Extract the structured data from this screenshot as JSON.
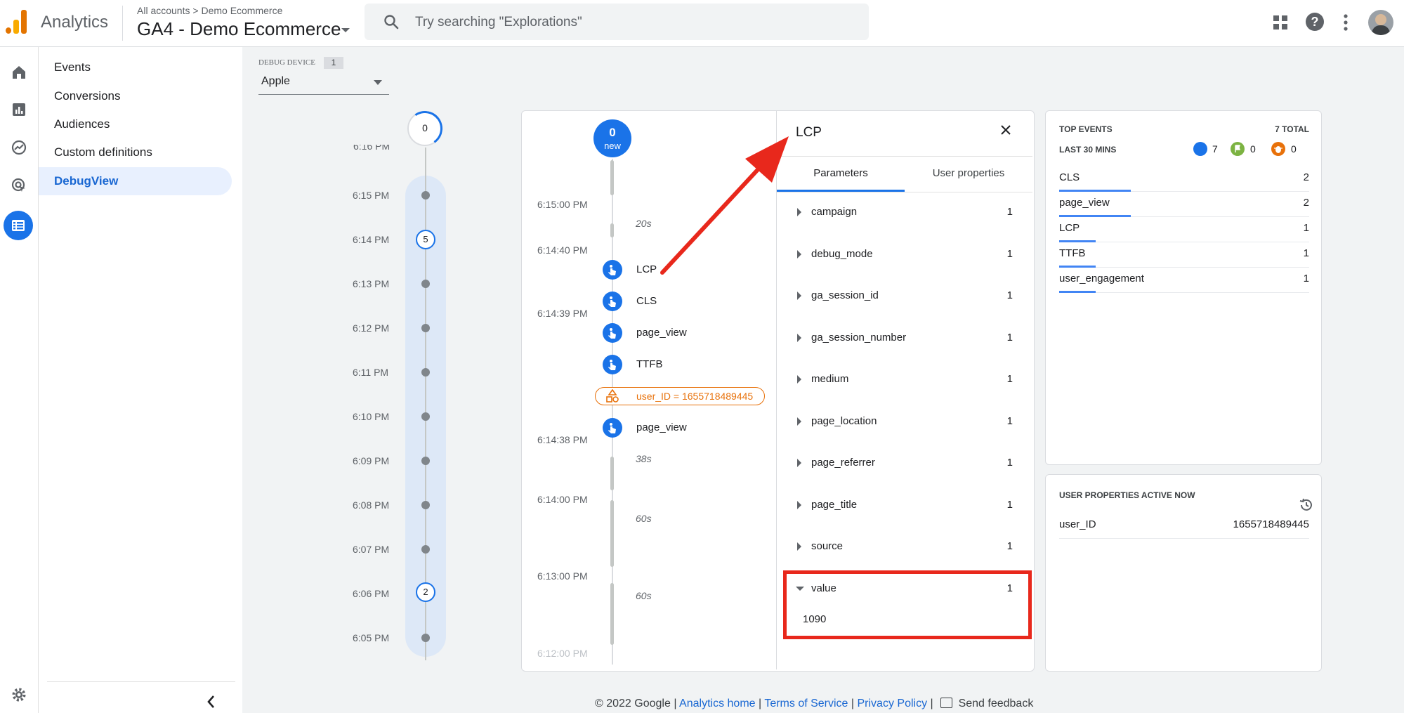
{
  "header": {
    "app_name": "Analytics",
    "breadcrumb_root": "All accounts",
    "breadcrumb_sep": ">",
    "breadcrumb_account": "Demo Ecommerce",
    "property_name": "GA4 - Demo Ecommerce",
    "search_placeholder": "Try searching \"Explorations\""
  },
  "nav": {
    "items": [
      {
        "label": "Events"
      },
      {
        "label": "Conversions"
      },
      {
        "label": "Audiences"
      },
      {
        "label": "Custom definitions"
      },
      {
        "label": "DebugView"
      }
    ]
  },
  "debug_device": {
    "label": "DEBUG DEVICE",
    "count": "1",
    "selected": "Apple"
  },
  "minutes_timeline": {
    "top_count": "0",
    "partial_label": "6:16 PM",
    "labels": [
      "6:15 PM",
      "6:14 PM",
      "6:13 PM",
      "6:12 PM",
      "6:11 PM",
      "6:10 PM",
      "6:09 PM",
      "6:08 PM",
      "6:07 PM",
      "6:06 PM",
      "6:05 PM"
    ],
    "badge_614": "5",
    "badge_606": "2"
  },
  "seconds_stream": {
    "new_count": "0",
    "new_label": "new",
    "times": [
      "6:15:00 PM",
      "6:14:40 PM",
      "6:14:39 PM",
      "6:14:38 PM",
      "6:14:00 PM",
      "6:13:00 PM",
      "6:12:00 PM"
    ],
    "gaps": [
      "20s",
      "38s",
      "60s",
      "60s"
    ],
    "events": [
      "LCP",
      "CLS",
      "page_view",
      "TTFB",
      "page_view"
    ],
    "user_property": "user_ID = 1655718489445"
  },
  "event_detail": {
    "title": "LCP",
    "tabs": [
      "Parameters",
      "User properties"
    ],
    "params": [
      {
        "name": "campaign",
        "count": "1"
      },
      {
        "name": "debug_mode",
        "count": "1"
      },
      {
        "name": "ga_session_id",
        "count": "1"
      },
      {
        "name": "ga_session_number",
        "count": "1"
      },
      {
        "name": "medium",
        "count": "1"
      },
      {
        "name": "page_location",
        "count": "1"
      },
      {
        "name": "page_referrer",
        "count": "1"
      },
      {
        "name": "page_title",
        "count": "1"
      },
      {
        "name": "source",
        "count": "1"
      },
      {
        "name": "value",
        "count": "1"
      }
    ],
    "value_expanded": "1090"
  },
  "top_events": {
    "title": "TOP EVENTS",
    "total": "7 TOTAL",
    "subtitle": "LAST 30 MINS",
    "counts": {
      "events": "7",
      "conversions": "0",
      "errors": "0"
    },
    "rows": [
      {
        "name": "CLS",
        "count": "2",
        "share": 1.0
      },
      {
        "name": "page_view",
        "count": "2",
        "share": 1.0
      },
      {
        "name": "LCP",
        "count": "1",
        "share": 0.5
      },
      {
        "name": "TTFB",
        "count": "1",
        "share": 0.5
      },
      {
        "name": "user_engagement",
        "count": "1",
        "share": 0.5
      }
    ]
  },
  "user_properties": {
    "title": "USER PROPERTIES ACTIVE NOW",
    "rows": [
      {
        "name": "user_ID",
        "value": "1655718489445"
      }
    ]
  },
  "footer": {
    "copyright": "© 2022 Google",
    "links": [
      "Analytics home",
      "Terms of Service",
      "Privacy Policy"
    ],
    "feedback": "Send feedback"
  },
  "colors": {
    "accent": "#1a73e8",
    "warning": "#e8710a",
    "annotation": "#e8281c"
  }
}
